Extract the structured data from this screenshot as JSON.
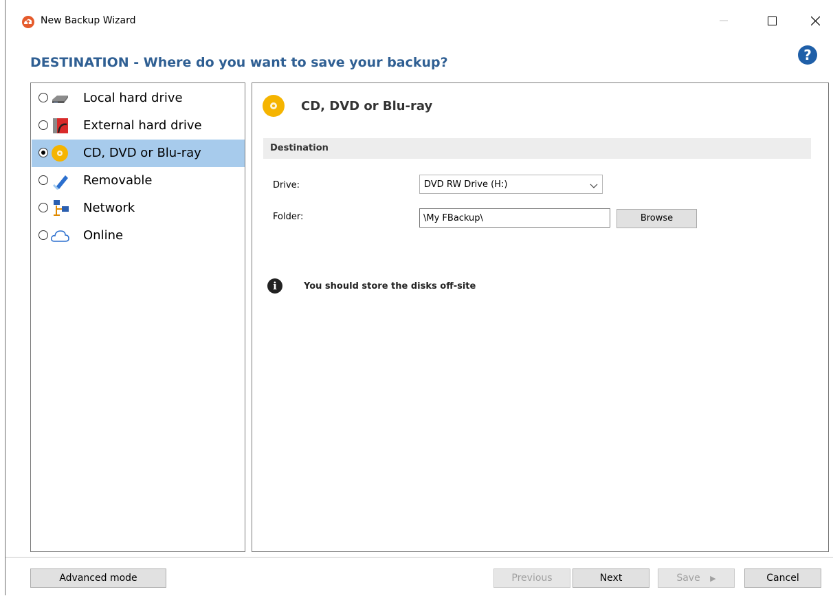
{
  "window": {
    "title": "New Backup Wizard"
  },
  "heading": "DESTINATION - Where do you want to save your backup?",
  "destinations": [
    {
      "label": "Local hard drive",
      "icon": "hard-drive-icon",
      "selected": false
    },
    {
      "label": "External hard drive",
      "icon": "external-drive-icon",
      "selected": false
    },
    {
      "label": "CD, DVD or Blu-ray",
      "icon": "disc-icon",
      "selected": true
    },
    {
      "label": "Removable",
      "icon": "usb-stick-icon",
      "selected": false
    },
    {
      "label": "Network",
      "icon": "network-icon",
      "selected": false
    },
    {
      "label": "Online",
      "icon": "cloud-icon",
      "selected": false
    }
  ],
  "detail": {
    "title": "CD, DVD or Blu-ray",
    "section": "Destination",
    "drive_label": "Drive:",
    "drive_value": "DVD RW Drive (H:)",
    "folder_label": "Folder:",
    "folder_value": "\\My FBackup\\",
    "browse_label": "Browse",
    "info_text": "You should store the disks off-site"
  },
  "footer": {
    "advanced": "Advanced mode",
    "previous": "Previous",
    "next": "Next",
    "save": "Save",
    "cancel": "Cancel"
  },
  "colors": {
    "heading": "#2f5f93",
    "selection": "#a7cbec",
    "help": "#1f5fa8",
    "disc": "#f5b400"
  }
}
